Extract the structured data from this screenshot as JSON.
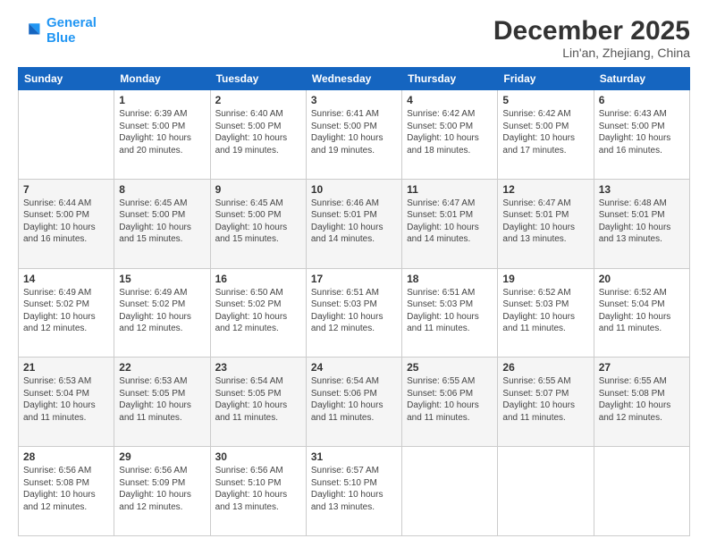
{
  "logo": {
    "line1": "General",
    "line2": "Blue"
  },
  "title": "December 2025",
  "subtitle": "Lin'an, Zhejiang, China",
  "days": [
    "Sunday",
    "Monday",
    "Tuesday",
    "Wednesday",
    "Thursday",
    "Friday",
    "Saturday"
  ],
  "weeks": [
    [
      {
        "num": "",
        "text": ""
      },
      {
        "num": "1",
        "text": "Sunrise: 6:39 AM\nSunset: 5:00 PM\nDaylight: 10 hours\nand 20 minutes."
      },
      {
        "num": "2",
        "text": "Sunrise: 6:40 AM\nSunset: 5:00 PM\nDaylight: 10 hours\nand 19 minutes."
      },
      {
        "num": "3",
        "text": "Sunrise: 6:41 AM\nSunset: 5:00 PM\nDaylight: 10 hours\nand 19 minutes."
      },
      {
        "num": "4",
        "text": "Sunrise: 6:42 AM\nSunset: 5:00 PM\nDaylight: 10 hours\nand 18 minutes."
      },
      {
        "num": "5",
        "text": "Sunrise: 6:42 AM\nSunset: 5:00 PM\nDaylight: 10 hours\nand 17 minutes."
      },
      {
        "num": "6",
        "text": "Sunrise: 6:43 AM\nSunset: 5:00 PM\nDaylight: 10 hours\nand 16 minutes."
      }
    ],
    [
      {
        "num": "7",
        "text": "Sunrise: 6:44 AM\nSunset: 5:00 PM\nDaylight: 10 hours\nand 16 minutes."
      },
      {
        "num": "8",
        "text": "Sunrise: 6:45 AM\nSunset: 5:00 PM\nDaylight: 10 hours\nand 15 minutes."
      },
      {
        "num": "9",
        "text": "Sunrise: 6:45 AM\nSunset: 5:00 PM\nDaylight: 10 hours\nand 15 minutes."
      },
      {
        "num": "10",
        "text": "Sunrise: 6:46 AM\nSunset: 5:01 PM\nDaylight: 10 hours\nand 14 minutes."
      },
      {
        "num": "11",
        "text": "Sunrise: 6:47 AM\nSunset: 5:01 PM\nDaylight: 10 hours\nand 14 minutes."
      },
      {
        "num": "12",
        "text": "Sunrise: 6:47 AM\nSunset: 5:01 PM\nDaylight: 10 hours\nand 13 minutes."
      },
      {
        "num": "13",
        "text": "Sunrise: 6:48 AM\nSunset: 5:01 PM\nDaylight: 10 hours\nand 13 minutes."
      }
    ],
    [
      {
        "num": "14",
        "text": "Sunrise: 6:49 AM\nSunset: 5:02 PM\nDaylight: 10 hours\nand 12 minutes."
      },
      {
        "num": "15",
        "text": "Sunrise: 6:49 AM\nSunset: 5:02 PM\nDaylight: 10 hours\nand 12 minutes."
      },
      {
        "num": "16",
        "text": "Sunrise: 6:50 AM\nSunset: 5:02 PM\nDaylight: 10 hours\nand 12 minutes."
      },
      {
        "num": "17",
        "text": "Sunrise: 6:51 AM\nSunset: 5:03 PM\nDaylight: 10 hours\nand 12 minutes."
      },
      {
        "num": "18",
        "text": "Sunrise: 6:51 AM\nSunset: 5:03 PM\nDaylight: 10 hours\nand 11 minutes."
      },
      {
        "num": "19",
        "text": "Sunrise: 6:52 AM\nSunset: 5:03 PM\nDaylight: 10 hours\nand 11 minutes."
      },
      {
        "num": "20",
        "text": "Sunrise: 6:52 AM\nSunset: 5:04 PM\nDaylight: 10 hours\nand 11 minutes."
      }
    ],
    [
      {
        "num": "21",
        "text": "Sunrise: 6:53 AM\nSunset: 5:04 PM\nDaylight: 10 hours\nand 11 minutes."
      },
      {
        "num": "22",
        "text": "Sunrise: 6:53 AM\nSunset: 5:05 PM\nDaylight: 10 hours\nand 11 minutes."
      },
      {
        "num": "23",
        "text": "Sunrise: 6:54 AM\nSunset: 5:05 PM\nDaylight: 10 hours\nand 11 minutes."
      },
      {
        "num": "24",
        "text": "Sunrise: 6:54 AM\nSunset: 5:06 PM\nDaylight: 10 hours\nand 11 minutes."
      },
      {
        "num": "25",
        "text": "Sunrise: 6:55 AM\nSunset: 5:06 PM\nDaylight: 10 hours\nand 11 minutes."
      },
      {
        "num": "26",
        "text": "Sunrise: 6:55 AM\nSunset: 5:07 PM\nDaylight: 10 hours\nand 11 minutes."
      },
      {
        "num": "27",
        "text": "Sunrise: 6:55 AM\nSunset: 5:08 PM\nDaylight: 10 hours\nand 12 minutes."
      }
    ],
    [
      {
        "num": "28",
        "text": "Sunrise: 6:56 AM\nSunset: 5:08 PM\nDaylight: 10 hours\nand 12 minutes."
      },
      {
        "num": "29",
        "text": "Sunrise: 6:56 AM\nSunset: 5:09 PM\nDaylight: 10 hours\nand 12 minutes."
      },
      {
        "num": "30",
        "text": "Sunrise: 6:56 AM\nSunset: 5:10 PM\nDaylight: 10 hours\nand 13 minutes."
      },
      {
        "num": "31",
        "text": "Sunrise: 6:57 AM\nSunset: 5:10 PM\nDaylight: 10 hours\nand 13 minutes."
      },
      {
        "num": "",
        "text": ""
      },
      {
        "num": "",
        "text": ""
      },
      {
        "num": "",
        "text": ""
      }
    ]
  ]
}
